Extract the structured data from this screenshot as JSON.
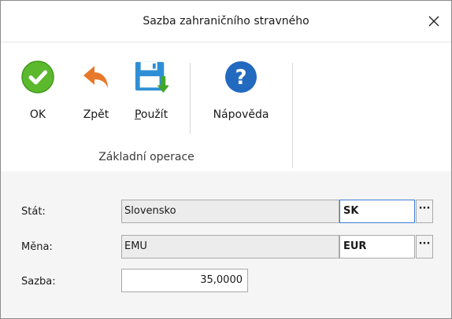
{
  "window": {
    "title": "Sazba zahraničního stravného"
  },
  "ribbon": {
    "ok_label": "OK",
    "back_label": "Zpět",
    "apply_label_underlined": "P",
    "apply_label_rest": "oužít",
    "help_label": "Nápověda",
    "group_label": "Základní operace"
  },
  "form": {
    "state_label": "Stát:",
    "state_name": "Slovensko",
    "state_code": "SK",
    "currency_label": "Měna:",
    "currency_name": "EMU",
    "currency_code": "EUR",
    "rate_label": "Sazba:",
    "rate_value": "35,0000",
    "ellipsis": "···"
  },
  "colors": {
    "ok_green": "#5cb82d",
    "back_orange": "#e8782a",
    "apply_blue": "#2f8fd6",
    "help_blue": "#2269c0",
    "focus_border": "#3c7fd5"
  }
}
